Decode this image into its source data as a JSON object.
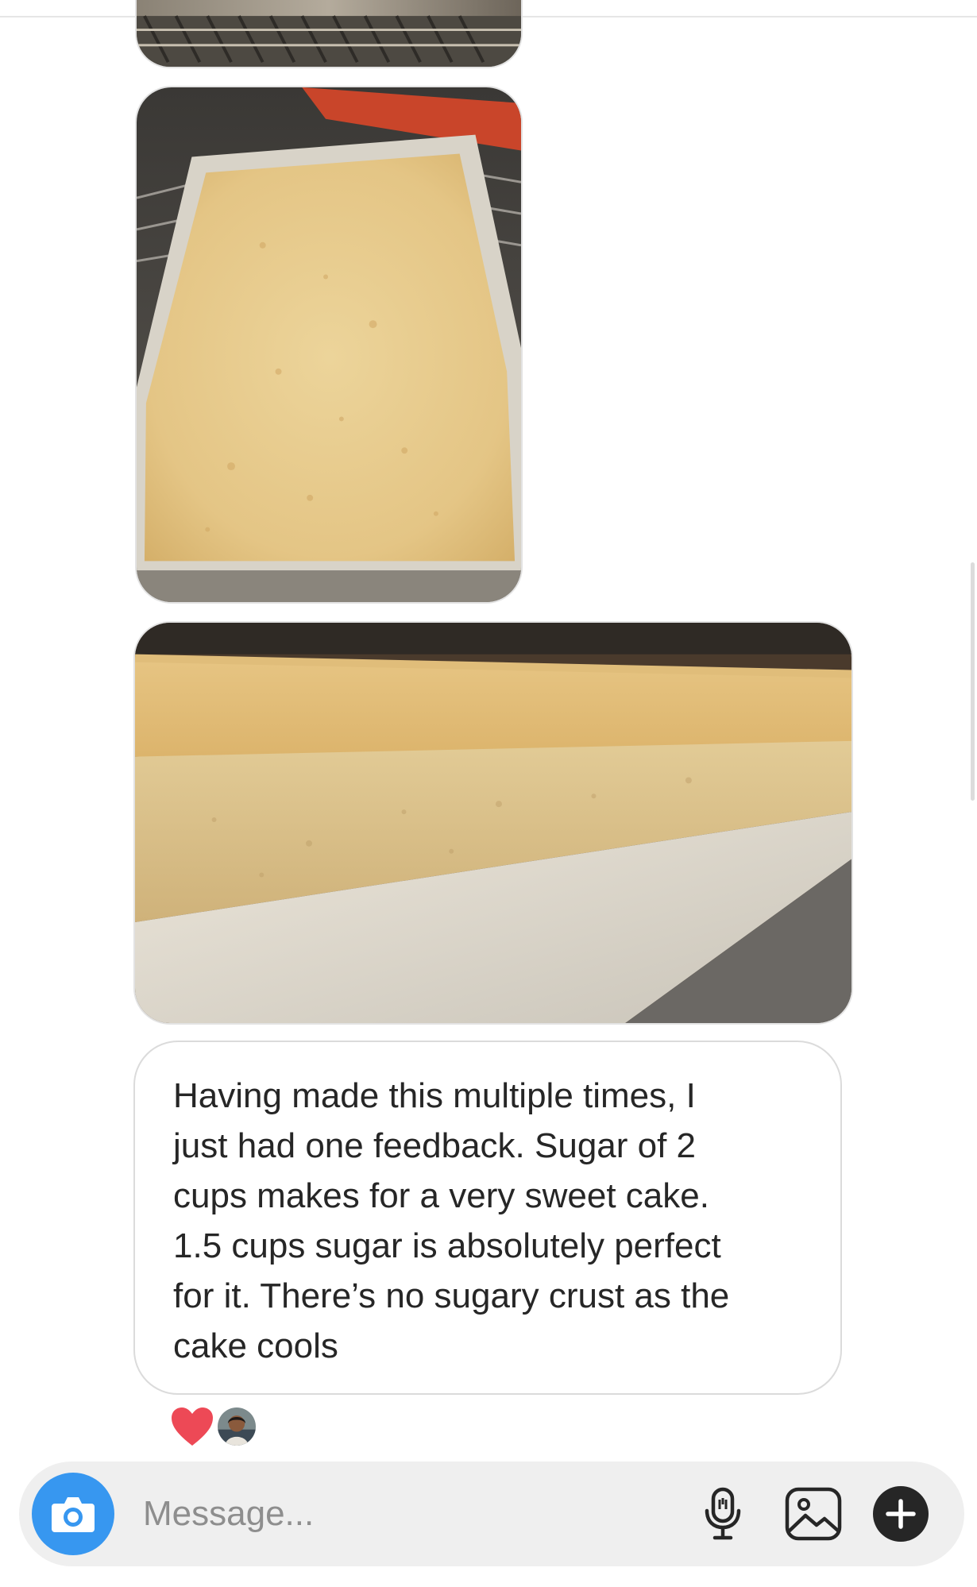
{
  "thread": {
    "photos": [
      {
        "alt": "cake on cooling rack"
      },
      {
        "alt": "baked sponge cake in tray"
      },
      {
        "alt": "side view of sponge cake"
      }
    ],
    "message": {
      "text": "Having made this multiple times, I\njust had one feedback. Sugar of 2\ncups makes for a very sweet cake.\n1.5 cups sugar is absolutely perfect\nfor it. There’s no sugary crust as the\ncake cools"
    },
    "reactions": {
      "icon": "heart-icon",
      "color": "#ed4956"
    }
  },
  "composer": {
    "placeholder": "Message...",
    "camera_icon": "camera-icon",
    "mic_icon": "microphone-icon",
    "gallery_icon": "image-gallery-icon",
    "plus_icon": "plus-icon",
    "accent_color": "#3797f0"
  }
}
